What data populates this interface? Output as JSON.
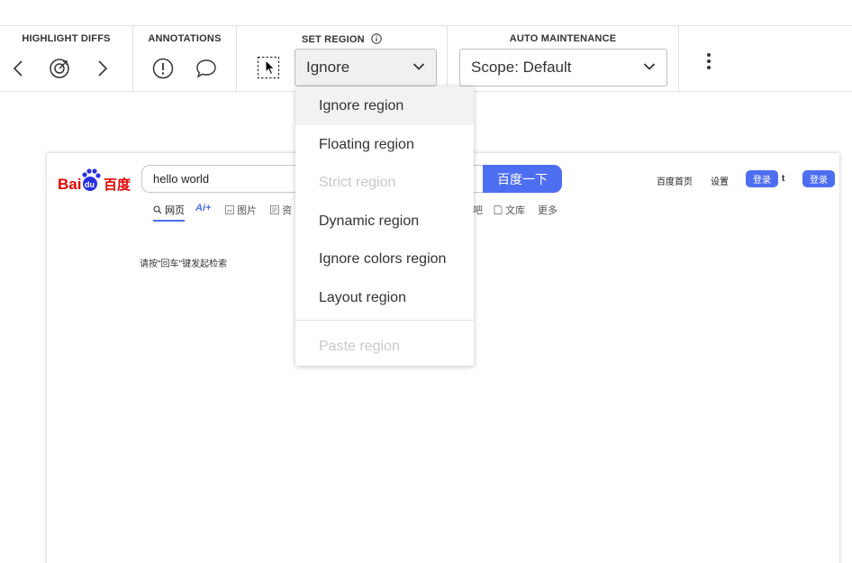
{
  "toolbar": {
    "highlight_diffs": {
      "label": "HIGHLIGHT DIFFS",
      "prev_icon": "chevron-left-icon",
      "target_icon": "target-icon",
      "next_icon": "chevron-right-icon"
    },
    "annotations": {
      "label": "ANNOTATIONS",
      "issue_icon": "exclamation-circle-icon",
      "comment_icon": "comment-icon"
    },
    "set_region": {
      "label": "SET REGION",
      "select_value": "Ignore",
      "draw_icon": "region-select-icon"
    },
    "auto_maintenance": {
      "label": "AUTO MAINTENANCE",
      "scope_value": "Scope: Default"
    },
    "more_icon": "kebab-menu-icon"
  },
  "region_menu": {
    "items": [
      {
        "label": "Ignore region",
        "state": "hover"
      },
      {
        "label": "Floating region",
        "state": "normal"
      },
      {
        "label": "Strict region",
        "state": "disabled"
      },
      {
        "label": "Dynamic region",
        "state": "normal"
      },
      {
        "label": "Ignore colors region",
        "state": "normal"
      },
      {
        "label": "Layout region",
        "state": "normal"
      }
    ],
    "paste": {
      "label": "Paste region",
      "state": "disabled"
    }
  },
  "preview": {
    "logo": {
      "text_left": "Bai",
      "text_paw": "du",
      "text_right": "百度",
      "brand_red": "#e10601",
      "brand_blue": "#2932e1"
    },
    "search_value": "hello world",
    "search_button": "百度一下",
    "tabs": [
      {
        "label": "网页",
        "icon": "search-icon",
        "active": true
      },
      {
        "label": "Ai+",
        "icon": "",
        "active": false
      },
      {
        "label": "图片",
        "icon": "image-icon",
        "active": false
      },
      {
        "label": "资",
        "icon": "news-icon",
        "active": false
      },
      {
        "label": "吧",
        "icon": "",
        "active": false
      },
      {
        "label": "文库",
        "icon": "doc-icon",
        "active": false
      },
      {
        "label": "更多",
        "icon": "",
        "active": false
      }
    ],
    "top_links": {
      "home": "百度首页",
      "settings": "设置",
      "login1": "登录",
      "stray": "t",
      "login2": "登录"
    },
    "hint": "请按\"回车\"键发起检索",
    "accent": "#4e6ef2"
  }
}
